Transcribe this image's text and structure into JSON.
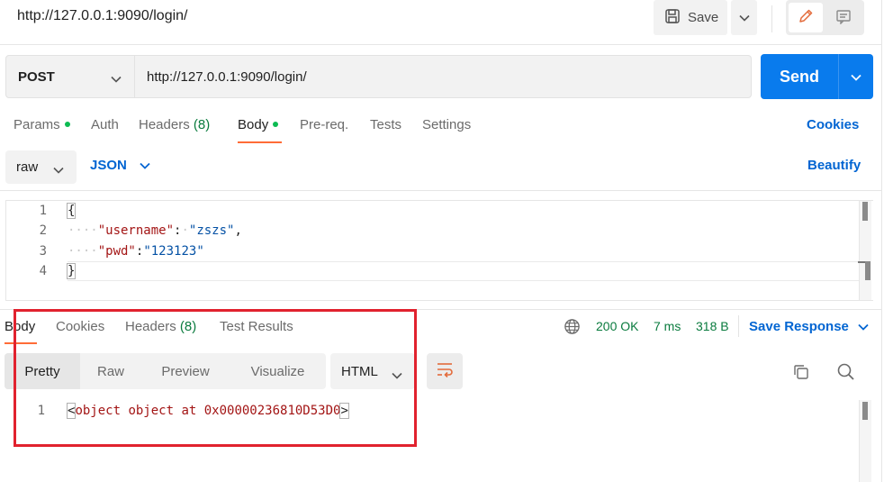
{
  "top": {
    "url_title": "http://127.0.0.1:9090/login/",
    "save_label": "Save"
  },
  "request": {
    "method": "POST",
    "url": "http://127.0.0.1:9090/login/",
    "send_label": "Send"
  },
  "tabs": {
    "params": "Params",
    "auth": "Auth",
    "headers": "Headers",
    "headers_count": "(8)",
    "body": "Body",
    "prereq": "Pre-req.",
    "tests": "Tests",
    "settings": "Settings",
    "cookies": "Cookies"
  },
  "body_options": {
    "mode": "raw",
    "language": "JSON",
    "beautify": "Beautify"
  },
  "editor": {
    "line_numbers": [
      "1",
      "2",
      "3",
      "4"
    ],
    "line1": "{",
    "line2_ws": "····",
    "line2_key": "\"username\"",
    "line2_colon": ":",
    "line2_sp": "·",
    "line2_val": "\"zszs\"",
    "line2_comma": ",",
    "line3_ws": "····",
    "line3_key": "\"pwd\"",
    "line3_colon": ":",
    "line3_val": "\"123123\"",
    "line4": "}"
  },
  "response": {
    "tabs": {
      "body": "Body",
      "cookies": "Cookies",
      "headers": "Headers",
      "headers_count": "(8)",
      "tests": "Test Results"
    },
    "status_code": "200 OK",
    "time": "7 ms",
    "size": "318 B",
    "save_response": "Save Response",
    "views": [
      "Pretty",
      "Raw",
      "Preview",
      "Visualize"
    ],
    "format": "HTML",
    "line_number": "1",
    "content_open": "<",
    "content_body": "object object at 0x00000236810D53D0",
    "content_close": ">"
  },
  "colors": {
    "accent": "#ff6c37",
    "send": "#097bed",
    "link": "#0265d2",
    "status_ok": "#0a7b3e",
    "highlight": "#e1222e"
  },
  "icons": [
    "save-icon",
    "chevron-down-icon",
    "pencil-icon",
    "document-icon",
    "globe-icon",
    "wrap-icon",
    "copy-icon",
    "search-icon"
  ]
}
